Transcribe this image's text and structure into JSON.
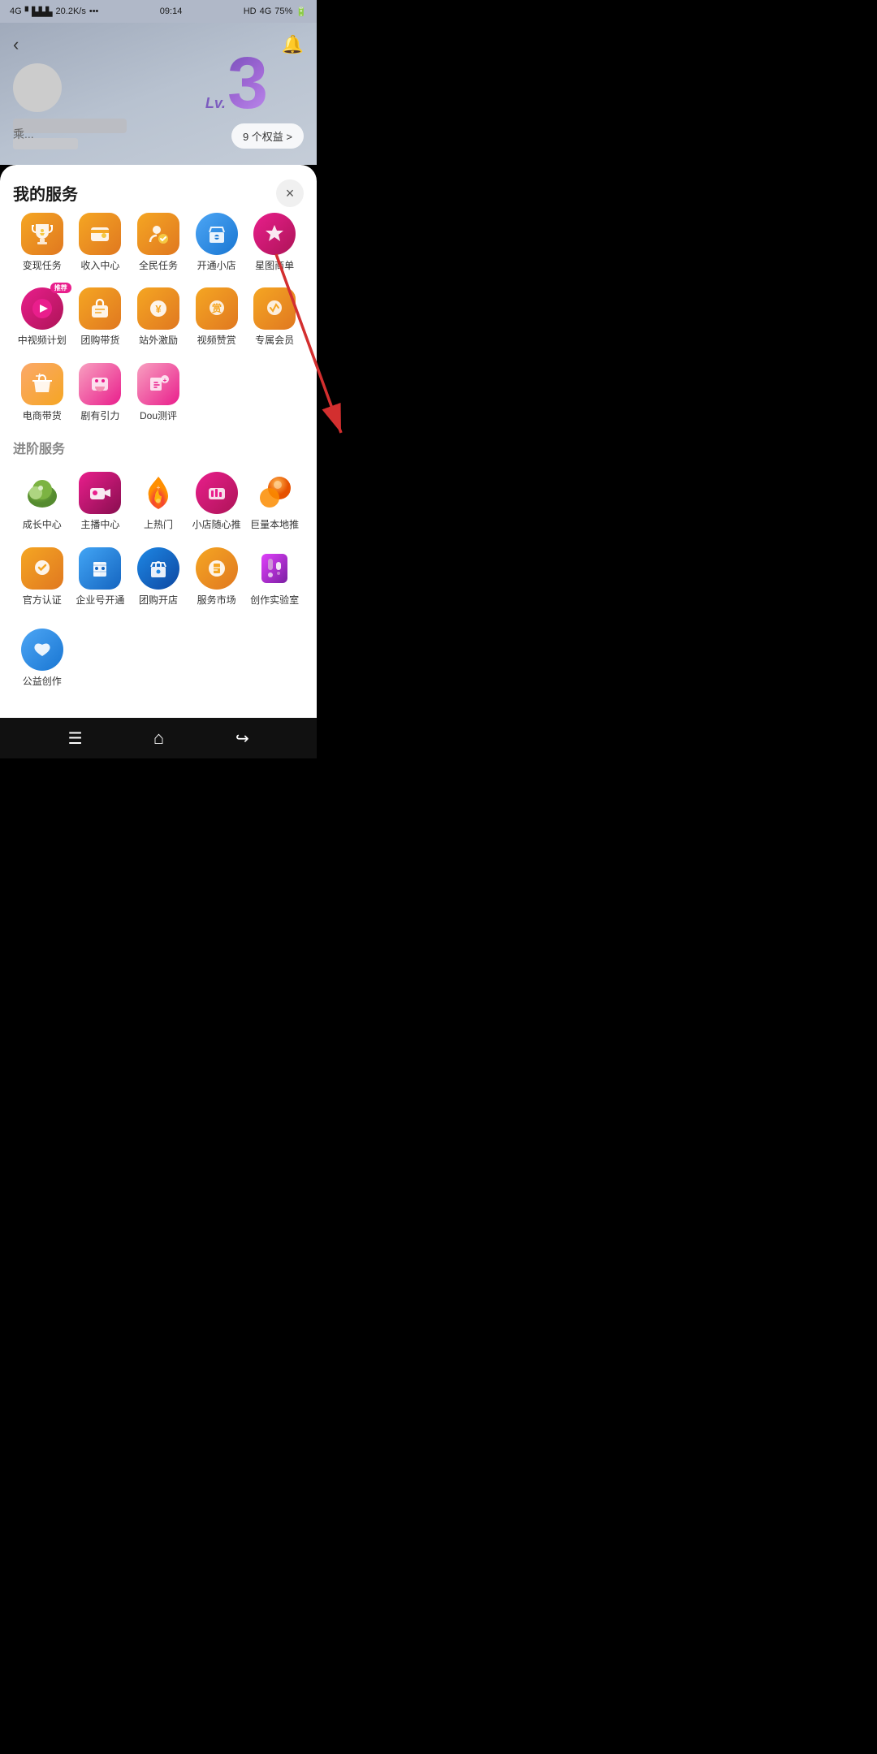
{
  "statusBar": {
    "signal": "4G",
    "signalStrength": "20.2K/s",
    "dots": "•••",
    "time": "09:14",
    "hd": "HD",
    "network": "4G",
    "battery": "75%"
  },
  "profile": {
    "level": "3",
    "lvLabel": "Lv.",
    "benefitsCount": "9 个权益 >",
    "tag": "乘..."
  },
  "modal": {
    "title": "我的服务",
    "closeLabel": "×",
    "services": [
      {
        "id": "bianzhen",
        "label": "变现任务",
        "icon": "trophy"
      },
      {
        "id": "shouru",
        "label": "收入中心",
        "icon": "wallet"
      },
      {
        "id": "quanmin",
        "label": "全民任务",
        "icon": "person"
      },
      {
        "id": "kaitong",
        "label": "开通小店",
        "icon": "shop"
      },
      {
        "id": "xingtushangdan",
        "label": "星图商单",
        "icon": "star"
      },
      {
        "id": "zhongshipin",
        "label": "中视频计划",
        "icon": "video",
        "badge": "推荐"
      },
      {
        "id": "tuangou",
        "label": "团购带货",
        "icon": "bag"
      },
      {
        "id": "zhanwai",
        "label": "站外激励",
        "icon": "money"
      },
      {
        "id": "zanshang",
        "label": "视频赞赏",
        "icon": "reward"
      },
      {
        "id": "zhuanshu",
        "label": "专属会员",
        "icon": "vip"
      },
      {
        "id": "dianshang",
        "label": "电商带货",
        "icon": "store"
      },
      {
        "id": "juyou",
        "label": "剧有引力",
        "icon": "drama"
      },
      {
        "id": "dou",
        "label": "Dou测评",
        "icon": "test"
      }
    ],
    "advancedTitle": "进阶服务",
    "advanced": [
      {
        "id": "chengzhang",
        "label": "成长中心",
        "icon": "growth"
      },
      {
        "id": "zhibo",
        "label": "主播中心",
        "icon": "live"
      },
      {
        "id": "reshang",
        "label": "上热门",
        "icon": "hot"
      },
      {
        "id": "suixin",
        "label": "小店随心推",
        "icon": "promote"
      },
      {
        "id": "juliang",
        "label": "巨量本地推",
        "icon": "local"
      },
      {
        "id": "guanfang",
        "label": "官方认证",
        "icon": "verify"
      },
      {
        "id": "qiye",
        "label": "企业号开通",
        "icon": "enterprise"
      },
      {
        "id": "tgkaidian",
        "label": "团购开店",
        "icon": "tgshop"
      },
      {
        "id": "fuwu",
        "label": "服务市场",
        "icon": "market"
      },
      {
        "id": "chuangzuo",
        "label": "创作实验室",
        "icon": "lab"
      },
      {
        "id": "gongyi",
        "label": "公益创作",
        "icon": "public"
      }
    ]
  },
  "bottomNav": {
    "menuLabel": "≡",
    "homeLabel": "⌂",
    "backLabel": "↩"
  }
}
